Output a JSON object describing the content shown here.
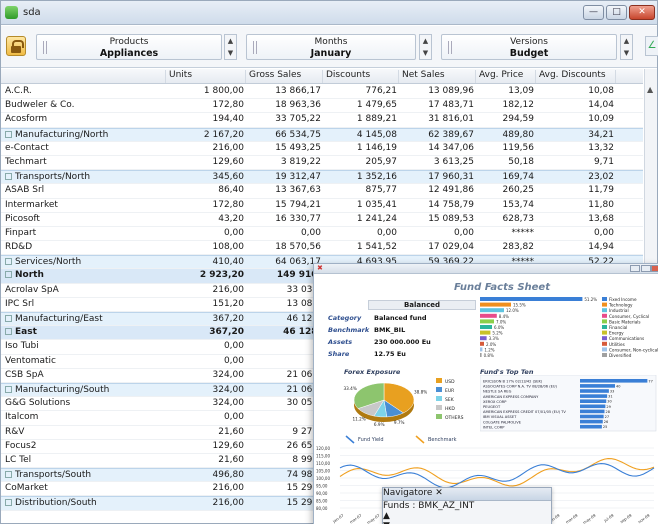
{
  "window": {
    "title": "sda"
  },
  "selectors": [
    {
      "name": "Products",
      "value": "Appliances"
    },
    {
      "name": "Months",
      "value": "January"
    },
    {
      "name": "Versions",
      "value": "Budget"
    }
  ],
  "grid": {
    "columns": [
      "",
      "Units",
      "Gross Sales",
      "Discounts",
      "Net Sales",
      "Avg. Price",
      "Avg. Discounts"
    ],
    "rows": [
      {
        "t": "n",
        "c": [
          "A.C.R.",
          "1 800,00",
          "13 866,17",
          "776,21",
          "13 089,96",
          "13,09",
          "10,08"
        ]
      },
      {
        "t": "n",
        "c": [
          "Budweler & Co.",
          "172,80",
          "18 963,36",
          "1 479,65",
          "17 483,71",
          "182,12",
          "14,04"
        ]
      },
      {
        "t": "n",
        "c": [
          "Acosform",
          "194,40",
          "33 705,22",
          "1 889,21",
          "31 816,01",
          "294,59",
          "10,09"
        ]
      },
      {
        "t": "g",
        "c": [
          "Manufacturing/North",
          "2 167,20",
          "66 534,75",
          "4 145,08",
          "62 389,67",
          "489,80",
          "34,21"
        ]
      },
      {
        "t": "n",
        "c": [
          "e-Contact",
          "216,00",
          "15 493,25",
          "1 146,19",
          "14 347,06",
          "119,56",
          "13,32"
        ]
      },
      {
        "t": "n",
        "c": [
          "Techmart",
          "129,60",
          "3 819,22",
          "205,97",
          "3 613,25",
          "50,18",
          "9,71"
        ]
      },
      {
        "t": "g",
        "c": [
          "Transports/North",
          "345,60",
          "19 312,47",
          "1 352,16",
          "17 960,31",
          "169,74",
          "23,02"
        ]
      },
      {
        "t": "n",
        "c": [
          "ASAB Srl",
          "86,40",
          "13 367,63",
          "875,77",
          "12 491,86",
          "260,25",
          "11,79"
        ]
      },
      {
        "t": "n",
        "c": [
          "Intermarket",
          "172,80",
          "15 794,21",
          "1 035,41",
          "14 758,79",
          "153,74",
          "11,80"
        ]
      },
      {
        "t": "n",
        "c": [
          "Picosoft",
          "43,20",
          "16 330,77",
          "1 241,24",
          "15 089,53",
          "628,73",
          "13,68"
        ]
      },
      {
        "t": "n",
        "c": [
          "Finpart",
          "0,00",
          "0,00",
          "0,00",
          "0,00",
          "*****",
          "0,00"
        ]
      },
      {
        "t": "n",
        "c": [
          "RD&D",
          "108,00",
          "18 570,56",
          "1 541,52",
          "17 029,04",
          "283,82",
          "14,94"
        ]
      },
      {
        "t": "g",
        "c": [
          "Services/North",
          "410,40",
          "64 063,17",
          "4 693,95",
          "59 369,22",
          "*****",
          "52,22"
        ]
      },
      {
        "t": "b",
        "c": [
          "North",
          "2 923,20",
          "149 910,",
          "",
          "",
          "",
          ""
        ]
      },
      {
        "t": "n",
        "c": [
          "Acrolav SpA",
          "216,00",
          "33 039,",
          "",
          "",
          "",
          ""
        ]
      },
      {
        "t": "n",
        "c": [
          "IPC Srl",
          "151,20",
          "13 088,",
          "",
          "",
          "",
          ""
        ]
      },
      {
        "t": "g",
        "c": [
          "Manufacturing/East",
          "367,20",
          "46 128,",
          "",
          "",
          "",
          ""
        ]
      },
      {
        "t": "b",
        "c": [
          "East",
          "367,20",
          "46 128,",
          "",
          "",
          "",
          ""
        ]
      },
      {
        "t": "n",
        "c": [
          "Iso Tubi",
          "0,00",
          "0,",
          "",
          "",
          "",
          ""
        ]
      },
      {
        "t": "n",
        "c": [
          "Ventomatic",
          "0,00",
          "0,",
          "",
          "",
          "",
          ""
        ]
      },
      {
        "t": "n",
        "c": [
          "CSB SpA",
          "324,00",
          "21 060,",
          "",
          "",
          "",
          ""
        ]
      },
      {
        "t": "g",
        "c": [
          "Manufacturing/South",
          "324,00",
          "21 060,",
          "",
          "",
          "",
          ""
        ]
      },
      {
        "t": "n",
        "c": [
          "G&G Solutions",
          "324,00",
          "30 055,",
          "",
          "",
          "",
          ""
        ]
      },
      {
        "t": "n",
        "c": [
          "Italcom",
          "0,00",
          "0,",
          "",
          "",
          "",
          ""
        ]
      },
      {
        "t": "n",
        "c": [
          "R&V",
          "21,60",
          "9 275,",
          "",
          "",
          "",
          ""
        ]
      },
      {
        "t": "n",
        "c": [
          "Focus2",
          "129,60",
          "26 655,",
          "",
          "",
          "",
          ""
        ]
      },
      {
        "t": "n",
        "c": [
          "LC Tel",
          "21,60",
          "8 995,",
          "",
          "",
          "",
          ""
        ]
      },
      {
        "t": "g",
        "c": [
          "Transports/South",
          "496,80",
          "74 981,",
          "",
          "",
          "",
          ""
        ]
      },
      {
        "t": "n",
        "c": [
          "CoMarket",
          "216,00",
          "15 295,",
          "",
          "",
          "",
          ""
        ]
      },
      {
        "t": "g",
        "c": [
          "Distribution/South",
          "216,00",
          "15 295,",
          "",
          "",
          "",
          ""
        ]
      }
    ]
  },
  "factsheet": {
    "title": "Fund Facts Sheet",
    "fund_header": "Balanced",
    "info": [
      {
        "label": "Category",
        "value": "Balanced fund"
      },
      {
        "label": "Benchmark",
        "value": "BMK_BIL"
      },
      {
        "label": "Assets",
        "value": "230 000.000 Eu"
      },
      {
        "label": "Share",
        "value": "12.75 Eu"
      }
    ],
    "forex_title": "Forex Exposure",
    "forex_legend": [
      "USD",
      "EUR",
      "SEK",
      "HKD",
      "OTHERS"
    ],
    "forex_colors": [
      "#e8a020",
      "#4a8fd4",
      "#7dd3e8",
      "#c8c8c8",
      "#8dc56e"
    ],
    "forex_values": [
      38.8,
      9.7,
      6.9,
      11.2,
      33.4
    ],
    "forex_labels": [
      "38.8%",
      "9.7%",
      "6.9%",
      "11.2%",
      "33.4%"
    ],
    "top_title": "Fund's Top Ten",
    "top_items": [
      "ERICSSON B 17% 02/13/42 (SEK)",
      "ASSOCIATES CORP N.A. TV 08/28/06 (EU)",
      "NESTLE SA REG",
      "AMERICAN EXPRESS COMPANY",
      "XEROX CORP",
      "PEUGEOT",
      "AMERICAN EXPRESS CREDIT 07/01/05 (EU) TV",
      "IBM VISUAL ASSET",
      "COLGATE PALMOLIVE",
      "INTEL CORP"
    ],
    "top_values": [
      77,
      40,
      33,
      31,
      30,
      29,
      28,
      27,
      26,
      25
    ],
    "sector_legend": [
      "Fixed Income",
      "Technology",
      "Industrial",
      "Consumer, Cyclical",
      "Basic Materials",
      "Financial",
      "Energy",
      "Communications",
      "Utilities",
      "Consumer, Non-cyclical",
      "Diversified"
    ],
    "sector_colors": [
      "#3a7fd6",
      "#f08f1e",
      "#5ec4e0",
      "#e84b8a",
      "#8bcf4a",
      "#2bb59c",
      "#c9c22a",
      "#7a5fd0",
      "#d65a3a",
      "#9fc2e8",
      "#a0a0a0"
    ],
    "sector_values": [
      51.2,
      15.5,
      12.0,
      8.4,
      7.0,
      6.0,
      5.2,
      3.3,
      2.0,
      1.2,
      0.8
    ],
    "sector_labels": [
      "51.2%",
      "15.5%",
      "12.0%",
      "8.4%",
      "7.0%",
      "6.0%",
      "5.2%",
      "3.3%",
      "2.0%",
      "1.2%",
      "0.8%"
    ],
    "perf_legend": [
      "Fund Yield",
      "Benchmark"
    ],
    "perf_colors": [
      "#3a7fd6",
      "#f0a020"
    ],
    "perf_yticks": [
      "120,00",
      "115,00",
      "110,00",
      "105,00",
      "100,00",
      "95,00",
      "90,00",
      "85,00",
      "80,00"
    ],
    "perf_xticks": [
      "jan-07",
      "mar-07",
      "may-07",
      "jul-07",
      "sep-07",
      "nov-07",
      "jan-08",
      "mar-08",
      "may-08",
      "jul-08",
      "sep-08",
      "nov-08",
      "jan-09",
      "mar-09",
      "may-09",
      "jul-09",
      "sep-09",
      "nov-09"
    ]
  },
  "navigator": {
    "title": "Navigatore",
    "selection": "Funds : BMK_AZ_INT"
  }
}
